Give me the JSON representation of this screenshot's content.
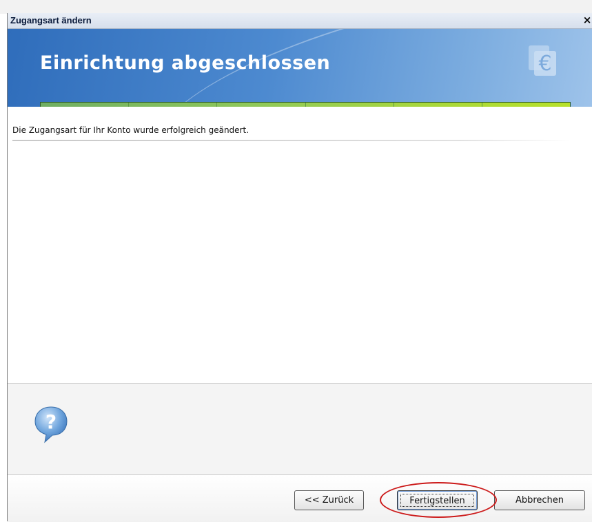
{
  "window": {
    "title": "Zugangsart ändern",
    "close_glyph": "×"
  },
  "header": {
    "title": "Einrichtung abgeschlossen",
    "icon": "euro-icon",
    "progress": {
      "value": 1.0,
      "segments": 6
    }
  },
  "main": {
    "message": "Die Zugangsart für Ihr Konto wurde erfolgreich geändert."
  },
  "help": {
    "icon": "question-bubble-icon"
  },
  "footer": {
    "back_label": "<< Zurück",
    "finish_label": "Fertigstellen",
    "cancel_label": "Abbrechen"
  },
  "colors": {
    "header_blue": "#2f6dbb",
    "progress_green": "#a9d83a",
    "highlight_red": "#cc1b1b"
  }
}
